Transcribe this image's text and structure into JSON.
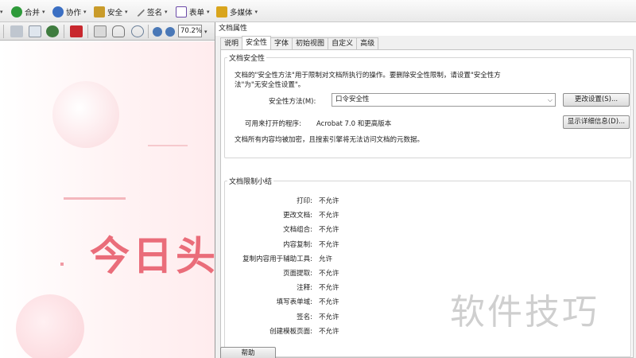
{
  "menubar": {
    "items": [
      {
        "label": "合并",
        "icon": "combine-icon",
        "color": "#2e9a3a"
      },
      {
        "label": "协作",
        "icon": "collaborate-icon",
        "color": "#3b6fc3"
      },
      {
        "label": "安全",
        "icon": "lock-icon",
        "color": "#c99b2a"
      },
      {
        "label": "签名",
        "icon": "pen-icon",
        "color": "#777777"
      },
      {
        "label": "表单",
        "icon": "form-icon",
        "color": "#6b4aa8"
      },
      {
        "label": "多媒体",
        "icon": "multimedia-icon",
        "color": "#d9a51d"
      }
    ]
  },
  "toolbar": {
    "zoom": "70.2%"
  },
  "document": {
    "title": "今日头"
  },
  "dialog": {
    "title": "文档属性",
    "tabs": [
      "说明",
      "安全性",
      "字体",
      "初始视图",
      "自定义",
      "高级"
    ],
    "active_tab": "安全性",
    "security": {
      "group_label": "文档安全性",
      "description": "文档的\"安全性方法\"用于限制对文档所执行的操作。要删除安全性限制，请设置\"安全性方法\"为\"无安全性设置\"。",
      "method_label": "安全性方法(M):",
      "method_value": "口令安全性",
      "change_button": "更改设置(S)...",
      "compat_label": "可用来打开的程序:",
      "compat_value": "Acrobat 7.0 和更高版本",
      "details_button": "显示详细信息(D)...",
      "encryption_note": "文档所有内容均被加密，且搜索引擎将无法访问文档的元数据。"
    },
    "summary": {
      "group_label": "文档限制小结",
      "rows": [
        {
          "key": "打印:",
          "value": "不允许"
        },
        {
          "key": "更改文档:",
          "value": "不允许"
        },
        {
          "key": "文档组合:",
          "value": "不允许"
        },
        {
          "key": "内容复制:",
          "value": "不允许"
        },
        {
          "key": "复制内容用于辅助工具:",
          "value": "允许"
        },
        {
          "key": "页面提取:",
          "value": "不允许"
        },
        {
          "key": "注释:",
          "value": "不允许"
        },
        {
          "key": "填写表单域:",
          "value": "不允许"
        },
        {
          "key": "签名:",
          "value": "不允许"
        },
        {
          "key": "创建模板页面:",
          "value": "不允许"
        }
      ]
    },
    "help_button": "帮助"
  },
  "watermark": "软件技巧"
}
